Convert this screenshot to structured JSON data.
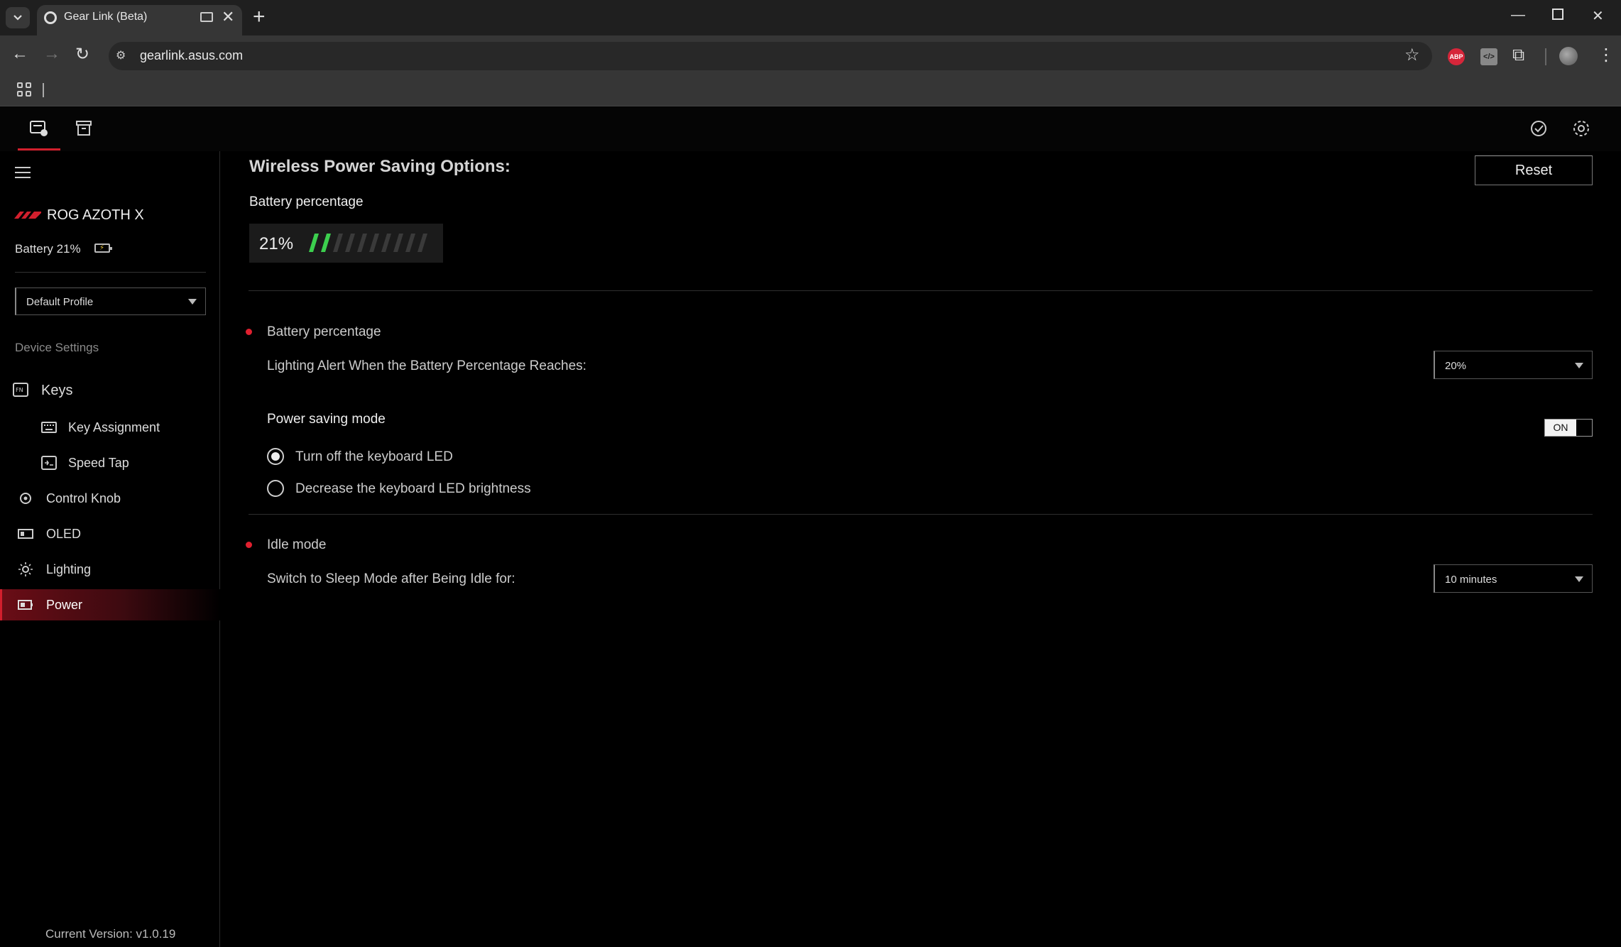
{
  "browser": {
    "tab_title": "Gear Link (Beta)",
    "url": "gearlink.asus.com",
    "new_tab_label": "+",
    "close_tab_label": "✕",
    "abp_label": "ABP"
  },
  "app": {
    "device_name": "ROG AZOTH X",
    "battery_label": "Battery 21%",
    "profile": "Default Profile",
    "device_settings_label": "Device Settings",
    "nav": {
      "keys": "Keys",
      "key_assignment": "Key Assignment",
      "speed_tap": "Speed Tap",
      "control_knob": "Control Knob",
      "oled": "OLED",
      "lighting": "Lighting",
      "power": "Power"
    },
    "active_nav": "Power",
    "version": "Current Version: v1.0.19"
  },
  "main": {
    "title": "Wireless Power Saving Options:",
    "reset_label": "Reset",
    "battery_heading": "Battery percentage",
    "battery_value": "21%",
    "battery_level": 0.21,
    "battery_section_label": "Battery percentage",
    "alert_label": "Lighting Alert When the Battery Percentage Reaches:",
    "alert_value": "20%",
    "power_saving_label": "Power saving mode",
    "power_saving_toggle": "ON",
    "radio_options": [
      {
        "label": "Turn off the keyboard LED",
        "selected": true
      },
      {
        "label": "Decrease the keyboard LED brightness",
        "selected": false
      }
    ],
    "idle_label": "Idle mode",
    "sleep_label": "Switch to Sleep Mode after Being Idle for:",
    "sleep_value": "10 minutes"
  },
  "colors": {
    "accent_red": "#d21f2d",
    "battery_green": "#3ccf4e",
    "background": "#000000"
  }
}
